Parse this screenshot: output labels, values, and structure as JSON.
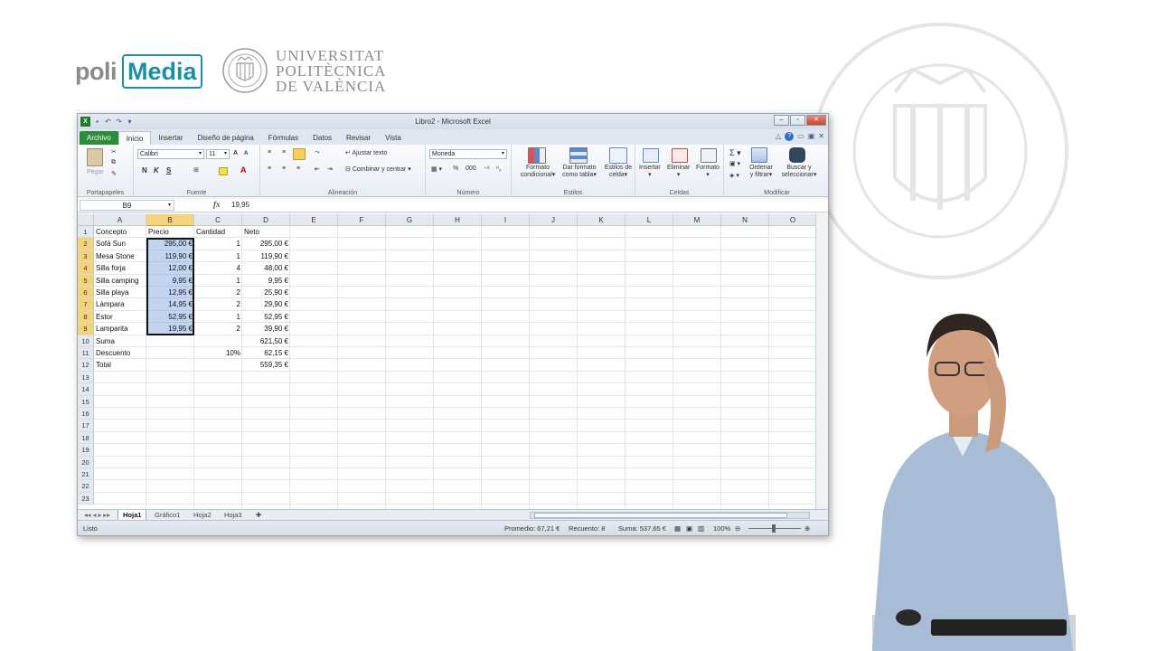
{
  "branding": {
    "poli": "poli",
    "media": "Media",
    "upv_lines": [
      "UNIVERSITAT",
      "POLITÈCNICA",
      "DE VALÈNCIA"
    ]
  },
  "window": {
    "title": "Libro2 - Microsoft Excel"
  },
  "tabs": [
    "Archivo",
    "Inicio",
    "Insertar",
    "Diseño de página",
    "Fórmulas",
    "Datos",
    "Revisar",
    "Vista"
  ],
  "ribbon": {
    "pegar": "Pegar",
    "font_name": "Calibri",
    "font_size": "11",
    "bold": "N",
    "italic": "K",
    "underline": "S",
    "wrap": "Ajustar texto",
    "merge": "Combinar y centrar",
    "number_format": "Moneda",
    "percent": "%",
    "thousands": "000",
    "cond_format": [
      "Formato",
      "condicional"
    ],
    "table_format": [
      "Dar formato",
      "como tabla"
    ],
    "cell_styles": [
      "Estilos de",
      "celda"
    ],
    "insert": "Insertar",
    "delete": "Eliminar",
    "format": "Formato",
    "sort": [
      "Ordenar",
      "y filtrar"
    ],
    "find": [
      "Buscar y",
      "seleccionar"
    ],
    "groups": [
      "Portapapeles",
      "Fuente",
      "Alineación",
      "Número",
      "Estilos",
      "Celdas",
      "Modificar"
    ]
  },
  "formula_bar": {
    "namebox": "B9",
    "fx": "fx",
    "value": "19,95"
  },
  "columns": [
    "A",
    "B",
    "C",
    "D",
    "E",
    "F",
    "G",
    "H",
    "I",
    "J",
    "K",
    "L",
    "M",
    "N",
    "O"
  ],
  "rows": [
    "1",
    "2",
    "3",
    "4",
    "5",
    "6",
    "7",
    "8",
    "9",
    "10",
    "11",
    "12",
    "13",
    "14",
    "15",
    "16",
    "17",
    "18",
    "19",
    "20",
    "21",
    "22",
    "23"
  ],
  "cells": {
    "headers": [
      "Concepto",
      "Precio",
      "Cantidad",
      "Neto"
    ],
    "items": [
      {
        "concepto": "Sofá Sun",
        "precio": "295,00 €",
        "cantidad": "1",
        "neto": "295,00 €"
      },
      {
        "concepto": "Mesa Stone",
        "precio": "119,90 €",
        "cantidad": "1",
        "neto": "119,90 €"
      },
      {
        "concepto": "Silla forja",
        "precio": "12,00 €",
        "cantidad": "4",
        "neto": "48,00 €"
      },
      {
        "concepto": "Silla camping",
        "precio": "9,95 €",
        "cantidad": "1",
        "neto": "9,95 €"
      },
      {
        "concepto": "Silla playa",
        "precio": "12,95 €",
        "cantidad": "2",
        "neto": "25,90 €"
      },
      {
        "concepto": "Lámpara",
        "precio": "14,95 €",
        "cantidad": "2",
        "neto": "29,90 €"
      },
      {
        "concepto": "Estor",
        "precio": "52,95 €",
        "cantidad": "1",
        "neto": "52,95 €"
      },
      {
        "concepto": "Lamparita",
        "precio": "19,95 €",
        "cantidad": "2",
        "neto": "39,90 €"
      }
    ],
    "suma_label": "Suma",
    "suma_value": "621,50 €",
    "descuento_label": "Descuento",
    "descuento_pct": "10%",
    "descuento_value": "62,15 €",
    "total_label": "Total",
    "total_value": "559,35 €"
  },
  "sheet_tabs": [
    "Hoja1",
    "Gráfico1",
    "Hoja2",
    "Hoja3"
  ],
  "status": {
    "ready": "Listo",
    "promedio": "Promedio: 67,21 €",
    "recuento": "Recuento: 8",
    "suma": "Suma: 537,65 €",
    "zoom": "100%"
  }
}
